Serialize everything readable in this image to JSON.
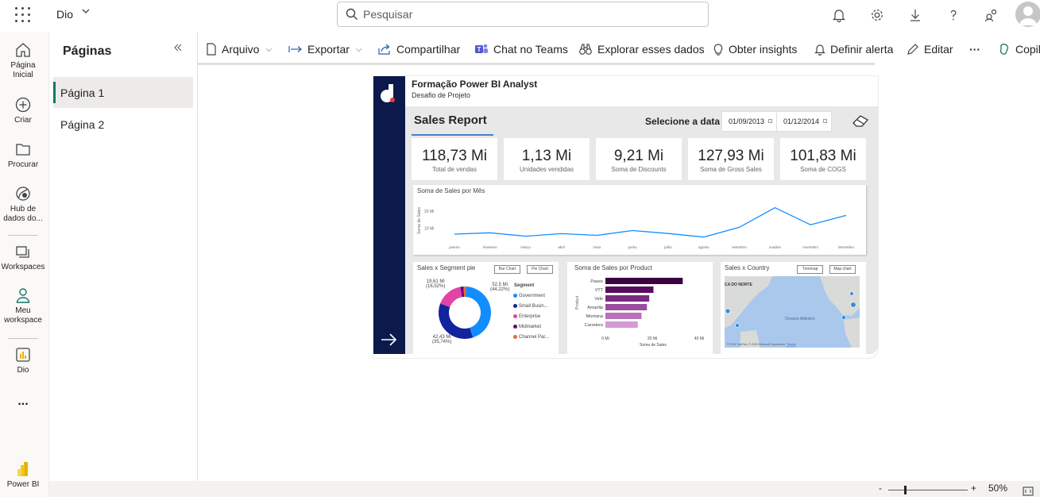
{
  "topbar": {
    "workspace_name": "Dio",
    "search_placeholder": "Pesquisar"
  },
  "leftnav": {
    "items": [
      {
        "label": "Página Inicial",
        "icon": "home-icon"
      },
      {
        "label": "Criar",
        "icon": "plus-circle-icon"
      },
      {
        "label": "Procurar",
        "icon": "folder-icon"
      },
      {
        "label": "Hub de dados do...",
        "icon": "data-hub-icon"
      },
      {
        "label": "Workspaces",
        "icon": "workspaces-icon"
      },
      {
        "label": "Meu workspace",
        "icon": "person-icon"
      },
      {
        "label": "Dio",
        "icon": "report-icon"
      },
      {
        "label": "...",
        "icon": "more-icon"
      },
      {
        "label": "Power BI",
        "icon": "powerbi-logo-icon"
      }
    ]
  },
  "pages_pane": {
    "title": "Páginas",
    "pages": [
      "Página 1",
      "Página 2"
    ],
    "active": "Página 1"
  },
  "toolbar": {
    "arquivo": "Arquivo",
    "exportar": "Exportar",
    "compartilhar": "Compartilhar",
    "chat_teams": "Chat no Teams",
    "explorar": "Explorar esses dados",
    "insights": "Obter insights",
    "alerta": "Definir alerta",
    "editar": "Editar",
    "more": "···",
    "copilot": "Copil"
  },
  "report": {
    "header_title": "Formação Power BI Analyst",
    "header_subtitle": "Desafio de Projeto",
    "title": "Sales Report",
    "date_label": "Selecione a data",
    "date_start": "01/09/2013",
    "date_end": "01/12/2014",
    "kpis": [
      {
        "value": "118,73 Mi",
        "label": "Total de vendas"
      },
      {
        "value": "1,13 Mi",
        "label": "Unidades vendidas"
      },
      {
        "value": "9,21 Mi",
        "label": "Soma de Discounts"
      },
      {
        "value": "127,93 Mi",
        "label": "Soma de Gross Sales"
      },
      {
        "value": "101,83 Mi",
        "label": "Soma de COGS"
      }
    ],
    "segment_title": "Sales x Segment pie",
    "segment_btn_bar": "Bar Chart",
    "segment_btn_pie": "Pie Chart",
    "segment_legend_title": "Segment",
    "segment_label_top_left": "19,61 Mi",
    "segment_label_top_left_pct": "(16,52%)",
    "segment_label_top_right": "52,5 Mi",
    "segment_label_top_right_pct": "(44,22%)",
    "segment_label_bottom": "42,43 Mi",
    "segment_label_bottom_pct": "(35,74%)",
    "product_title": "Soma de Sales por Product",
    "product_ylabel": "Product",
    "product_xlabel": "Soma de Sales",
    "product_ticks": [
      "0 Mi",
      "20 Mi",
      "40 Mi"
    ],
    "country_title": "Sales x Country",
    "country_btn_treemap": "Treemap",
    "country_btn_map": "Map chart",
    "map_text_north": "CA DO NORTE",
    "map_text_ocean": "Oceano Atlântico",
    "map_attrib": "© 2024 TomTom, © 2024 Microsoft Corporation, ",
    "map_terms_link": "Termos"
  },
  "chart_data": [
    {
      "type": "line",
      "title": "Soma de Sales por Mês",
      "ylabel": "Soma de Sales",
      "xlabel": "",
      "categories": [
        "janeiro",
        "fevereiro",
        "março",
        "abril",
        "maio",
        "junho",
        "julho",
        "agosto",
        "setembro",
        "outubro",
        "novembro",
        "dezembro"
      ],
      "values": [
        6.5,
        7.3,
        5.3,
        6.8,
        5.8,
        8.6,
        6.9,
        4.8,
        10.5,
        22.0,
        12.0,
        17.5
      ],
      "yticks": [
        "10 Mi",
        "20 Mi"
      ],
      "ylim": [
        0,
        27
      ],
      "color": "#118dff"
    },
    {
      "type": "pie",
      "title": "Sales x Segment pie",
      "categories": [
        "Government",
        "Small Busin...",
        "Enterprise",
        "Midmarket",
        "Channel Par..."
      ],
      "values": [
        52.5,
        42.43,
        19.61,
        2.4,
        1.8
      ],
      "colors": [
        "#118dff",
        "#12239e",
        "#e044a7",
        "#6b007b",
        "#e66c37"
      ]
    },
    {
      "type": "bar",
      "title": "Soma de Sales por Product",
      "categories": [
        "Paseo",
        "VTT",
        "Velo",
        "Amarilla",
        "Montana",
        "Carretera"
      ],
      "values": [
        33,
        20.5,
        18.7,
        17.7,
        15.4,
        13.8
      ],
      "xlim": [
        0,
        40
      ],
      "colors": [
        "#3d0340",
        "#5a0a5e",
        "#7a2a7e",
        "#9a4c9e",
        "#b772b9",
        "#d59ad6"
      ]
    }
  ],
  "statusbar": {
    "zoom": "50%"
  }
}
